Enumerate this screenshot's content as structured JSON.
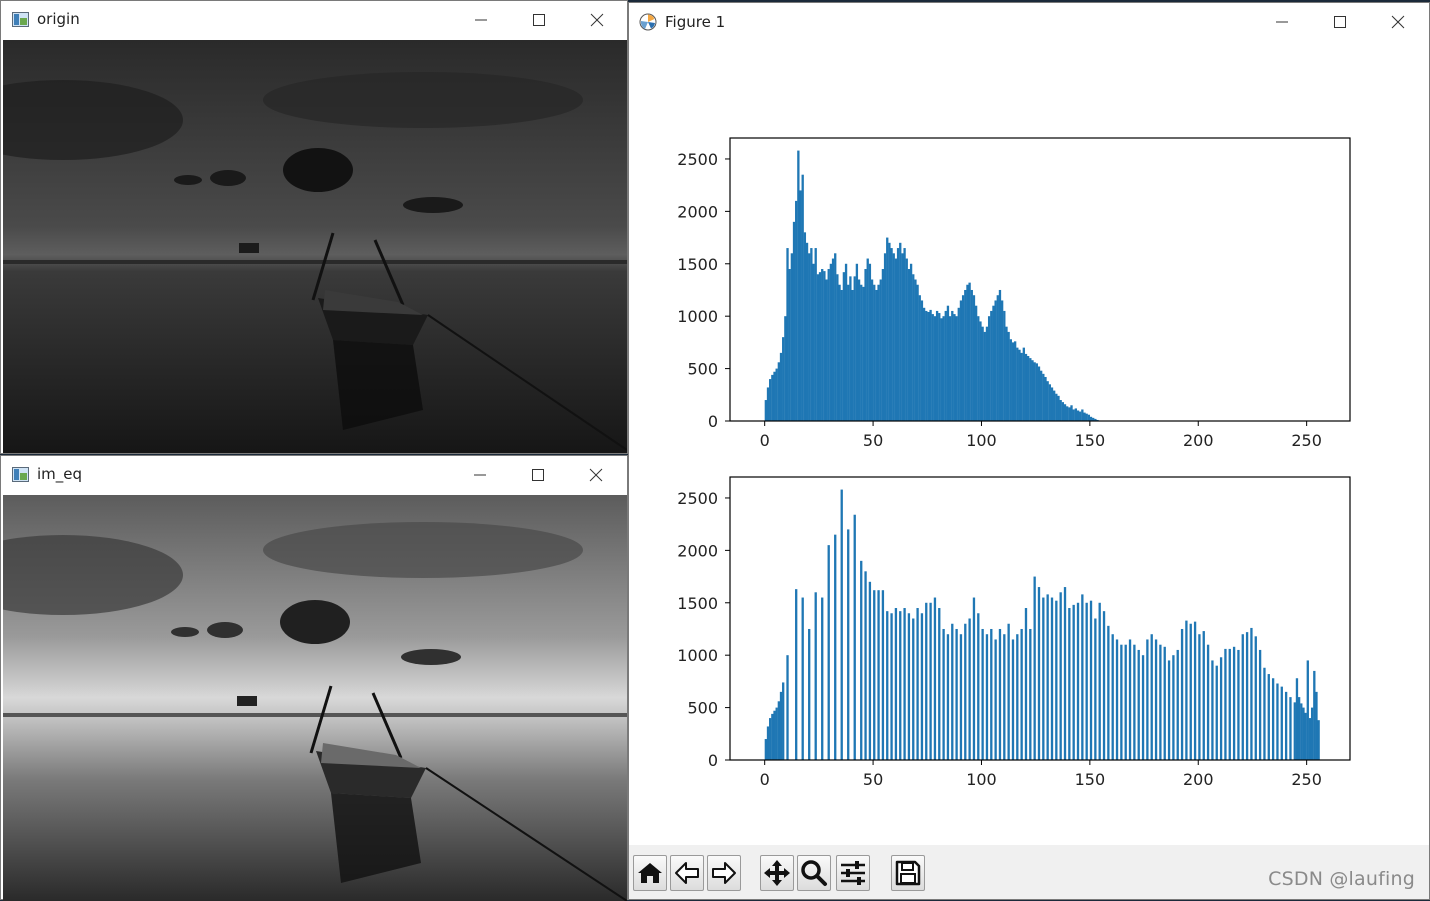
{
  "windows": {
    "origin": {
      "title": "origin"
    },
    "im_eq": {
      "title": "im_eq"
    },
    "figure": {
      "title": "Figure 1"
    }
  },
  "icons": {
    "minimize": "minimize-icon",
    "maximize": "maximize-icon",
    "close": "close-icon",
    "toolbar": [
      "home-icon",
      "back-arrow-icon",
      "forward-arrow-icon",
      "pan-icon",
      "zoom-icon",
      "configure-subplots-icon",
      "save-icon"
    ]
  },
  "watermark": "CSDN @laufing",
  "colors": {
    "bar": "#1f77b4",
    "toolbar_bg": "#f0f0f0"
  },
  "chart_data": [
    {
      "type": "bar",
      "xlim": [
        -16,
        270
      ],
      "ylim": [
        0,
        2700
      ],
      "x_ticks": [
        "0",
        "50",
        "100",
        "150",
        "200",
        "250"
      ],
      "y_ticks": [
        "0",
        "500",
        "1000",
        "1500",
        "2000",
        "2500"
      ],
      "bins": [
        {
          "x": 0,
          "y": 200
        },
        {
          "x": 1,
          "y": 320
        },
        {
          "x": 2,
          "y": 400
        },
        {
          "x": 3,
          "y": 440
        },
        {
          "x": 4,
          "y": 470
        },
        {
          "x": 5,
          "y": 500
        },
        {
          "x": 6,
          "y": 560
        },
        {
          "x": 7,
          "y": 650
        },
        {
          "x": 8,
          "y": 800
        },
        {
          "x": 9,
          "y": 1000
        },
        {
          "x": 10,
          "y": 1650
        },
        {
          "x": 11,
          "y": 1450
        },
        {
          "x": 12,
          "y": 1600
        },
        {
          "x": 13,
          "y": 1900
        },
        {
          "x": 14,
          "y": 2100
        },
        {
          "x": 15,
          "y": 2580
        },
        {
          "x": 16,
          "y": 2200
        },
        {
          "x": 17,
          "y": 2350
        },
        {
          "x": 18,
          "y": 1800
        },
        {
          "x": 19,
          "y": 1700
        },
        {
          "x": 20,
          "y": 1600
        },
        {
          "x": 21,
          "y": 1650
        },
        {
          "x": 22,
          "y": 1500
        },
        {
          "x": 23,
          "y": 1650
        },
        {
          "x": 24,
          "y": 1400
        },
        {
          "x": 25,
          "y": 1420
        },
        {
          "x": 26,
          "y": 1450
        },
        {
          "x": 27,
          "y": 1430
        },
        {
          "x": 28,
          "y": 1350
        },
        {
          "x": 29,
          "y": 1450
        },
        {
          "x": 30,
          "y": 1500
        },
        {
          "x": 31,
          "y": 1550
        },
        {
          "x": 32,
          "y": 1600
        },
        {
          "x": 33,
          "y": 1400
        },
        {
          "x": 34,
          "y": 1300
        },
        {
          "x": 35,
          "y": 1250
        },
        {
          "x": 36,
          "y": 1420
        },
        {
          "x": 37,
          "y": 1500
        },
        {
          "x": 38,
          "y": 1300
        },
        {
          "x": 39,
          "y": 1380
        },
        {
          "x": 40,
          "y": 1250
        },
        {
          "x": 41,
          "y": 1380
        },
        {
          "x": 42,
          "y": 1500
        },
        {
          "x": 43,
          "y": 1350
        },
        {
          "x": 44,
          "y": 1300
        },
        {
          "x": 45,
          "y": 1280
        },
        {
          "x": 46,
          "y": 1450
        },
        {
          "x": 47,
          "y": 1550
        },
        {
          "x": 48,
          "y": 1500
        },
        {
          "x": 49,
          "y": 1350
        },
        {
          "x": 50,
          "y": 1300
        },
        {
          "x": 51,
          "y": 1250
        },
        {
          "x": 52,
          "y": 1300
        },
        {
          "x": 53,
          "y": 1350
        },
        {
          "x": 54,
          "y": 1450
        },
        {
          "x": 55,
          "y": 1600
        },
        {
          "x": 56,
          "y": 1750
        },
        {
          "x": 57,
          "y": 1700
        },
        {
          "x": 58,
          "y": 1650
        },
        {
          "x": 59,
          "y": 1600
        },
        {
          "x": 60,
          "y": 1550
        },
        {
          "x": 61,
          "y": 1650
        },
        {
          "x": 62,
          "y": 1700
        },
        {
          "x": 63,
          "y": 1600
        },
        {
          "x": 64,
          "y": 1650
        },
        {
          "x": 65,
          "y": 1550
        },
        {
          "x": 66,
          "y": 1450
        },
        {
          "x": 67,
          "y": 1500
        },
        {
          "x": 68,
          "y": 1400
        },
        {
          "x": 69,
          "y": 1350
        },
        {
          "x": 70,
          "y": 1300
        },
        {
          "x": 71,
          "y": 1200
        },
        {
          "x": 72,
          "y": 1150
        },
        {
          "x": 73,
          "y": 1080
        },
        {
          "x": 74,
          "y": 1050
        },
        {
          "x": 75,
          "y": 1040
        },
        {
          "x": 76,
          "y": 1060
        },
        {
          "x": 77,
          "y": 1020
        },
        {
          "x": 78,
          "y": 1000
        },
        {
          "x": 79,
          "y": 1050
        },
        {
          "x": 80,
          "y": 1030
        },
        {
          "x": 81,
          "y": 980
        },
        {
          "x": 82,
          "y": 1000
        },
        {
          "x": 83,
          "y": 1050
        },
        {
          "x": 84,
          "y": 1100
        },
        {
          "x": 85,
          "y": 1000
        },
        {
          "x": 86,
          "y": 1050
        },
        {
          "x": 87,
          "y": 1020
        },
        {
          "x": 88,
          "y": 1000
        },
        {
          "x": 89,
          "y": 1080
        },
        {
          "x": 90,
          "y": 1150
        },
        {
          "x": 91,
          "y": 1200
        },
        {
          "x": 92,
          "y": 1250
        },
        {
          "x": 93,
          "y": 1300
        },
        {
          "x": 94,
          "y": 1320
        },
        {
          "x": 95,
          "y": 1250
        },
        {
          "x": 96,
          "y": 1200
        },
        {
          "x": 97,
          "y": 1100
        },
        {
          "x": 98,
          "y": 1000
        },
        {
          "x": 99,
          "y": 950
        },
        {
          "x": 100,
          "y": 900
        },
        {
          "x": 101,
          "y": 850
        },
        {
          "x": 102,
          "y": 900
        },
        {
          "x": 103,
          "y": 1000
        },
        {
          "x": 104,
          "y": 1050
        },
        {
          "x": 105,
          "y": 1100
        },
        {
          "x": 106,
          "y": 1150
        },
        {
          "x": 107,
          "y": 1200
        },
        {
          "x": 108,
          "y": 1250
        },
        {
          "x": 109,
          "y": 1150
        },
        {
          "x": 110,
          "y": 1050
        },
        {
          "x": 111,
          "y": 900
        },
        {
          "x": 112,
          "y": 850
        },
        {
          "x": 113,
          "y": 780
        },
        {
          "x": 114,
          "y": 750
        },
        {
          "x": 115,
          "y": 760
        },
        {
          "x": 116,
          "y": 700
        },
        {
          "x": 117,
          "y": 680
        },
        {
          "x": 118,
          "y": 650
        },
        {
          "x": 119,
          "y": 700
        },
        {
          "x": 120,
          "y": 640
        },
        {
          "x": 121,
          "y": 620
        },
        {
          "x": 122,
          "y": 600
        },
        {
          "x": 123,
          "y": 580
        },
        {
          "x": 124,
          "y": 560
        },
        {
          "x": 125,
          "y": 550
        },
        {
          "x": 126,
          "y": 520
        },
        {
          "x": 127,
          "y": 480
        },
        {
          "x": 128,
          "y": 450
        },
        {
          "x": 129,
          "y": 420
        },
        {
          "x": 130,
          "y": 380
        },
        {
          "x": 131,
          "y": 350
        },
        {
          "x": 132,
          "y": 320
        },
        {
          "x": 133,
          "y": 290
        },
        {
          "x": 134,
          "y": 260
        },
        {
          "x": 135,
          "y": 240
        },
        {
          "x": 136,
          "y": 200
        },
        {
          "x": 137,
          "y": 180
        },
        {
          "x": 138,
          "y": 160
        },
        {
          "x": 139,
          "y": 140
        },
        {
          "x": 140,
          "y": 130
        },
        {
          "x": 141,
          "y": 150
        },
        {
          "x": 142,
          "y": 110
        },
        {
          "x": 143,
          "y": 120
        },
        {
          "x": 144,
          "y": 100
        },
        {
          "x": 145,
          "y": 90
        },
        {
          "x": 146,
          "y": 110
        },
        {
          "x": 147,
          "y": 80
        },
        {
          "x": 148,
          "y": 70
        },
        {
          "x": 149,
          "y": 60
        },
        {
          "x": 150,
          "y": 40
        },
        {
          "x": 151,
          "y": 30
        },
        {
          "x": 152,
          "y": 20
        },
        {
          "x": 153,
          "y": 10
        }
      ]
    },
    {
      "type": "bar",
      "xlim": [
        -16,
        270
      ],
      "ylim": [
        0,
        2700
      ],
      "x_ticks": [
        "0",
        "50",
        "100",
        "150",
        "200",
        "250"
      ],
      "y_ticks": [
        "0",
        "500",
        "1000",
        "1500",
        "2000",
        "2500"
      ],
      "bins": [
        {
          "x": 0,
          "y": 200
        },
        {
          "x": 1,
          "y": 320
        },
        {
          "x": 2,
          "y": 400
        },
        {
          "x": 3,
          "y": 440
        },
        {
          "x": 4,
          "y": 470
        },
        {
          "x": 5,
          "y": 500
        },
        {
          "x": 6,
          "y": 560
        },
        {
          "x": 7,
          "y": 650
        },
        {
          "x": 8,
          "y": 740
        },
        {
          "x": 10,
          "y": 1000
        },
        {
          "x": 14,
          "y": 1630
        },
        {
          "x": 17,
          "y": 1550
        },
        {
          "x": 20,
          "y": 1250
        },
        {
          "x": 23,
          "y": 1600
        },
        {
          "x": 26,
          "y": 1550
        },
        {
          "x": 29,
          "y": 2050
        },
        {
          "x": 32,
          "y": 2150
        },
        {
          "x": 35,
          "y": 2580
        },
        {
          "x": 38,
          "y": 2200
        },
        {
          "x": 41,
          "y": 2340
        },
        {
          "x": 44,
          "y": 1900
        },
        {
          "x": 46,
          "y": 1800
        },
        {
          "x": 48,
          "y": 1700
        },
        {
          "x": 50,
          "y": 1620
        },
        {
          "x": 52,
          "y": 1620
        },
        {
          "x": 54,
          "y": 1620
        },
        {
          "x": 56,
          "y": 1420
        },
        {
          "x": 58,
          "y": 1400
        },
        {
          "x": 60,
          "y": 1450
        },
        {
          "x": 62,
          "y": 1420
        },
        {
          "x": 64,
          "y": 1450
        },
        {
          "x": 66,
          "y": 1400
        },
        {
          "x": 68,
          "y": 1350
        },
        {
          "x": 70,
          "y": 1450
        },
        {
          "x": 72,
          "y": 1400
        },
        {
          "x": 74,
          "y": 1500
        },
        {
          "x": 76,
          "y": 1500
        },
        {
          "x": 78,
          "y": 1550
        },
        {
          "x": 80,
          "y": 1450
        },
        {
          "x": 82,
          "y": 1250
        },
        {
          "x": 84,
          "y": 1200
        },
        {
          "x": 86,
          "y": 1300
        },
        {
          "x": 88,
          "y": 1250
        },
        {
          "x": 90,
          "y": 1200
        },
        {
          "x": 92,
          "y": 1300
        },
        {
          "x": 94,
          "y": 1350
        },
        {
          "x": 96,
          "y": 1550
        },
        {
          "x": 98,
          "y": 1400
        },
        {
          "x": 100,
          "y": 1250
        },
        {
          "x": 102,
          "y": 1200
        },
        {
          "x": 104,
          "y": 1250
        },
        {
          "x": 106,
          "y": 1150
        },
        {
          "x": 108,
          "y": 1250
        },
        {
          "x": 110,
          "y": 1200
        },
        {
          "x": 112,
          "y": 1300
        },
        {
          "x": 114,
          "y": 1150
        },
        {
          "x": 116,
          "y": 1200
        },
        {
          "x": 118,
          "y": 1250
        },
        {
          "x": 120,
          "y": 1450
        },
        {
          "x": 122,
          "y": 1250
        },
        {
          "x": 124,
          "y": 1750
        },
        {
          "x": 126,
          "y": 1650
        },
        {
          "x": 128,
          "y": 1550
        },
        {
          "x": 130,
          "y": 1580
        },
        {
          "x": 132,
          "y": 1550
        },
        {
          "x": 134,
          "y": 1520
        },
        {
          "x": 136,
          "y": 1600
        },
        {
          "x": 138,
          "y": 1650
        },
        {
          "x": 140,
          "y": 1450
        },
        {
          "x": 142,
          "y": 1480
        },
        {
          "x": 144,
          "y": 1500
        },
        {
          "x": 146,
          "y": 1580
        },
        {
          "x": 148,
          "y": 1500
        },
        {
          "x": 150,
          "y": 1520
        },
        {
          "x": 152,
          "y": 1350
        },
        {
          "x": 154,
          "y": 1500
        },
        {
          "x": 156,
          "y": 1420
        },
        {
          "x": 158,
          "y": 1280
        },
        {
          "x": 160,
          "y": 1200
        },
        {
          "x": 162,
          "y": 1150
        },
        {
          "x": 164,
          "y": 1100
        },
        {
          "x": 166,
          "y": 1100
        },
        {
          "x": 168,
          "y": 1150
        },
        {
          "x": 170,
          "y": 1100
        },
        {
          "x": 172,
          "y": 1050
        },
        {
          "x": 174,
          "y": 1000
        },
        {
          "x": 176,
          "y": 1150
        },
        {
          "x": 178,
          "y": 1200
        },
        {
          "x": 180,
          "y": 1150
        },
        {
          "x": 182,
          "y": 1100
        },
        {
          "x": 184,
          "y": 1080
        },
        {
          "x": 186,
          "y": 950
        },
        {
          "x": 188,
          "y": 1000
        },
        {
          "x": 190,
          "y": 1050
        },
        {
          "x": 192,
          "y": 1250
        },
        {
          "x": 194,
          "y": 1330
        },
        {
          "x": 196,
          "y": 1300
        },
        {
          "x": 198,
          "y": 1320
        },
        {
          "x": 200,
          "y": 1200
        },
        {
          "x": 202,
          "y": 1230
        },
        {
          "x": 204,
          "y": 1100
        },
        {
          "x": 206,
          "y": 950
        },
        {
          "x": 208,
          "y": 900
        },
        {
          "x": 210,
          "y": 980
        },
        {
          "x": 212,
          "y": 1060
        },
        {
          "x": 214,
          "y": 1060
        },
        {
          "x": 216,
          "y": 1080
        },
        {
          "x": 218,
          "y": 1050
        },
        {
          "x": 220,
          "y": 1200
        },
        {
          "x": 222,
          "y": 1220
        },
        {
          "x": 224,
          "y": 1260
        },
        {
          "x": 226,
          "y": 1180
        },
        {
          "x": 228,
          "y": 1050
        },
        {
          "x": 230,
          "y": 880
        },
        {
          "x": 232,
          "y": 820
        },
        {
          "x": 234,
          "y": 780
        },
        {
          "x": 236,
          "y": 730
        },
        {
          "x": 238,
          "y": 700
        },
        {
          "x": 240,
          "y": 650
        },
        {
          "x": 242,
          "y": 600
        },
        {
          "x": 244,
          "y": 550
        },
        {
          "x": 245,
          "y": 780
        },
        {
          "x": 246,
          "y": 600
        },
        {
          "x": 247,
          "y": 540
        },
        {
          "x": 248,
          "y": 500
        },
        {
          "x": 249,
          "y": 450
        },
        {
          "x": 250,
          "y": 950
        },
        {
          "x": 251,
          "y": 400
        },
        {
          "x": 252,
          "y": 500
        },
        {
          "x": 253,
          "y": 850
        },
        {
          "x": 254,
          "y": 650
        },
        {
          "x": 255,
          "y": 380
        }
      ]
    }
  ]
}
